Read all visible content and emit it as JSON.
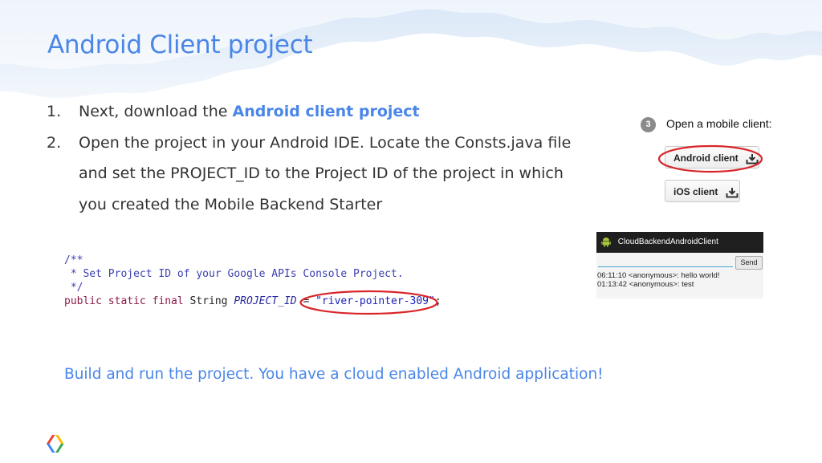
{
  "slide": {
    "title": "Android Client project",
    "steps": [
      {
        "num": "1.",
        "prefix": "Next, download the ",
        "link": "Android client project"
      },
      {
        "num": "2.",
        "text": "Open the project in your Android IDE. Locate the Consts.java file and set the PROJECT_ID to the Project ID of the project in which you created the Mobile Backend Starter"
      }
    ],
    "code": {
      "line1": "/**",
      "line2": " * Set Project ID of your Google APIs Console Project.",
      "line3": " */",
      "kw": "public static final ",
      "type": "String ",
      "ident": "PROJECT_ID",
      "eq": " = ",
      "value": "\"river-pointer-309\"",
      "semi": ";"
    },
    "mobile_client": {
      "step_number": "3",
      "label": "Open a mobile client:",
      "buttons": [
        "Android client",
        "iOS client"
      ],
      "icon": "download-icon"
    },
    "app_screen": {
      "app_title": "CloudBackendAndroidClient",
      "send_label": "Send",
      "messages": [
        "06:11:10 <anonymous>: hello world!",
        "01:13:42 <anonymous>: test"
      ]
    },
    "footer": "Build and run the project. You have a cloud enabled Android application!",
    "colors": {
      "accent": "#4a86e8",
      "highlight_ring": "#d9262b",
      "logo": [
        "#4285f4",
        "#ea4335",
        "#fbbc05",
        "#34a853"
      ]
    }
  }
}
